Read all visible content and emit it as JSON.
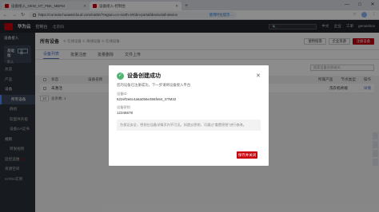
{
  "browser": {
    "tabs": [
      {
        "title": "设备接入_NEW_NT_PBK_MBPM",
        "active": false
      },
      {
        "title": "设备接入-控制台",
        "active": true
      }
    ],
    "new_tab": "+",
    "url": "https://console.huaweicloud.com/iotdm/?region=cn-north-4#/dm-portal/device/all-device",
    "url_badge": "使用时位提示...",
    "window_controls": [
      "—",
      "□",
      "✕"
    ]
  },
  "topnav": {
    "brand": "华为云",
    "console": "控制台",
    "region": "北京四",
    "search_placeholder": "",
    "right": [
      "中文",
      "企业",
      "工单",
      "genuisbox"
    ]
  },
  "sidebar": {
    "title": "设备接入",
    "instance": {
      "name": "基础版",
      "sub": "默认",
      "tag": "详情"
    },
    "items": [
      {
        "label": "总览",
        "child": false
      },
      {
        "label": "产品",
        "child": false
      },
      {
        "label": "设备",
        "child": false,
        "group": true
      },
      {
        "label": "所有设备",
        "child": true,
        "active": true
      },
      {
        "label": "群组",
        "child": true
      },
      {
        "label": "软固件升级",
        "child": true
      },
      {
        "label": "设备CA证书",
        "child": true
      },
      {
        "label": "规则",
        "child": false,
        "group": true
      },
      {
        "label": "转发规则",
        "child": true
      },
      {
        "label": "监控运维",
        "child": false,
        "dot": true
      },
      {
        "label": "资源空间",
        "child": false
      },
      {
        "label": "IoTDA实例",
        "child": false
      }
    ]
  },
  "page": {
    "title": "所有设备",
    "desc": "① 在线设备 ① 离线设备 ② 在线设备",
    "buttons": {
      "doc": "使用指南",
      "bought": "企业资源",
      "register": "注册设备"
    },
    "tabs": [
      "设备列表",
      "批量注册",
      "批量删除",
      "文件上传"
    ],
    "search_placeholder": "搜索设备名称或ID",
    "table": {
      "headers": [
        "状态",
        "设备名称",
        "设备标识码",
        "所属资源空间",
        "所属产品",
        "节点类型",
        "操作"
      ],
      "rows": [
        {
          "status": "未激活",
          "name": "",
          "code": "",
          "space": "",
          "product": "洗衣机终端",
          "node": "",
          "op": "详情"
        }
      ]
    },
    "pager": {
      "total": "总条数: 1",
      "size": "10"
    }
  },
  "modal": {
    "title": "设备创建成功",
    "close": "✕",
    "desc": "您的设备已注册成功，下一步请将设备接入平台",
    "id_label": "设备ID",
    "id_value": "622ef2e6c4a6a056e356fe84_STM32",
    "secret_label": "设备密钥",
    "secret_value": "12345678",
    "note": "为保证安全，密钥在设备详情页内不可见。如遗忘密钥，可通过\"重置密钥\"进行修改。",
    "button": "保存并关闭"
  },
  "colors": {
    "brand": "#c7000b",
    "accent": "#526ecc",
    "success": "#50b371"
  }
}
